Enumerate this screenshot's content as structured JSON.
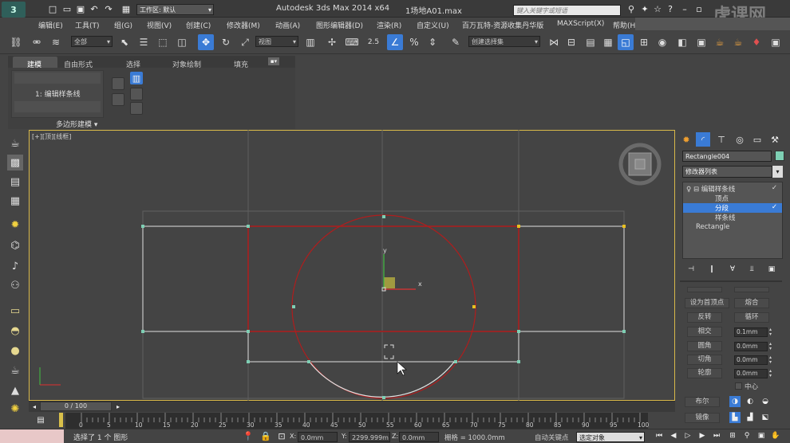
{
  "title_bar": {
    "workspace_label": "工作区: 默认",
    "app_title": "Autodesk 3ds Max  2014 x64",
    "file_name": "1场地A01.max",
    "search_placeholder": "键入关键字或短语",
    "logo_text": "虎课网"
  },
  "menu": [
    "编辑(E)",
    "工具(T)",
    "组(G)",
    "视图(V)",
    "创建(C)",
    "修改器(M)",
    "动画(A)",
    "图形编辑器(D)",
    "渲染(R)",
    "自定义(U)",
    "百万瓦特-资源收集丹华版",
    "MAXScript(X)",
    "帮助(H)"
  ],
  "toolbar": {
    "selection_filter": "全部",
    "ref_coord": "视图",
    "snap_value": "2.5",
    "named_selection": "创建选择集"
  },
  "ribbon": {
    "tabs": [
      "建模",
      "自由形式",
      "选择",
      "对象绘制",
      "填充"
    ],
    "active_tab": "建模",
    "sub_label": "1: 编辑样条线",
    "panel_label": "多边形建模"
  },
  "viewport": {
    "label": "[+][顶][线框]",
    "axis_x": "x",
    "axis_y": "y"
  },
  "command_panel": {
    "object_name": "Rectangle004",
    "object_color": "#7ecfb4",
    "modifier_list": "修改器列表",
    "stack": [
      {
        "label": "编辑样条线",
        "level": 0
      },
      {
        "label": "顶点",
        "level": 1
      },
      {
        "label": "分段",
        "level": 1,
        "selected": true
      },
      {
        "label": "样条线",
        "level": 1
      },
      {
        "label": "Rectangle",
        "level": 0
      }
    ],
    "rollout_buttons": [
      "设为首顶点",
      "熔合",
      "反转",
      "循环",
      "相交",
      "圆角",
      "切角",
      "轮廓"
    ],
    "rollout_top": [
      "",
      ""
    ],
    "values": [
      "0.1mm",
      "0.0mm",
      "0.0mm",
      "0.0mm"
    ],
    "center_label": "中心",
    "boolean_label": "布尔",
    "mirror_label": "镜像"
  },
  "timeline": {
    "frame": "0 / 100",
    "ticks": [
      "0",
      "5",
      "10",
      "15",
      "20",
      "25",
      "30",
      "35",
      "40",
      "45",
      "50",
      "55",
      "60",
      "65",
      "70",
      "75",
      "80",
      "85",
      "90",
      "95",
      "100"
    ]
  },
  "status": {
    "selection": "选择了 1 个 图形",
    "x_label": "X:",
    "x_value": "0.0mm",
    "y_label": "Y:",
    "y_value": "2299.999m",
    "z_label": "Z:",
    "z_value": "0.0mm",
    "grid": "栅格 = 1000.0mm",
    "auto_key": "自动关键点",
    "key_filter": "选定对象"
  },
  "colors": {
    "accent": "#3a7bd5",
    "selection_red": "#b01d1d",
    "spline_white": "#e0e0e0",
    "vertex_green": "#7ecfb4",
    "frame_yellow": "#d9b94a"
  }
}
